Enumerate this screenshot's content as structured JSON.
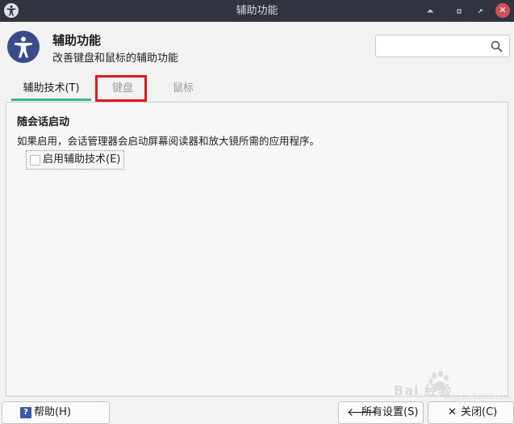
{
  "window": {
    "title": "辅助功能",
    "controls": {
      "shade": "⏶",
      "minimize": "▫",
      "maximize": "▫",
      "close": "✕"
    }
  },
  "header": {
    "title": "辅助功能",
    "subtitle": "改善键盘和鼠标的辅助功能",
    "search": {
      "value": "",
      "placeholder": ""
    }
  },
  "tabs": [
    {
      "label": "辅助技术(T)",
      "active": true
    },
    {
      "label": "键盘(R)",
      "active": false
    },
    {
      "label": "鼠标(M)",
      "active": false
    }
  ],
  "content": {
    "section_title": "随会话启动",
    "description": "如果启用，会话管理器会启动屏幕阅读器和放大镜所需的应用程序。",
    "checkbox": {
      "label": "启用辅助技术(E)",
      "checked": false
    }
  },
  "buttons": {
    "help": "帮助(H)",
    "all_settings": "所有设置(S)",
    "close": "关闭(C)"
  },
  "watermark": {
    "text": "Bai 经验",
    "sub": "jingyan.baidu.com"
  },
  "colors": {
    "titlebar": "#2f343f",
    "accent_tab": "#36b39b",
    "highlight": "#e3161b",
    "close_button": "#d3505b",
    "icon_bg": "#3b4a8a"
  }
}
